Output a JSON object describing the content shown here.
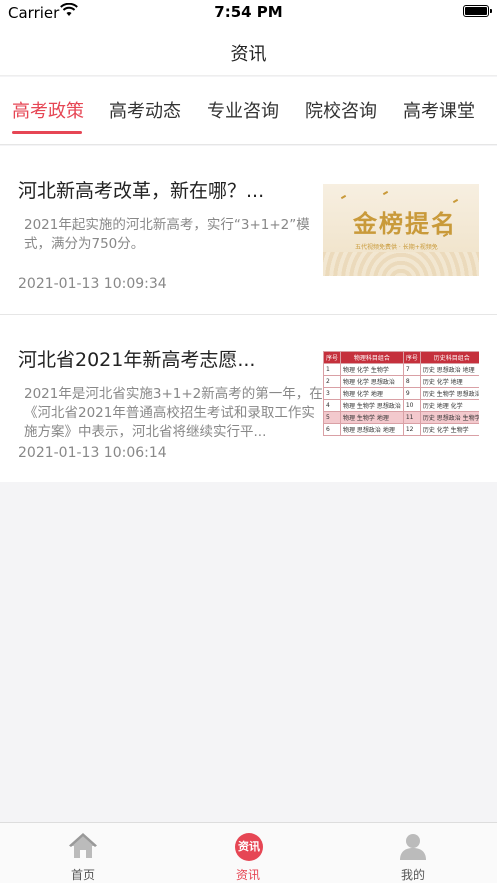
{
  "status_bar": {
    "carrier": "Carrier",
    "time": "7:54 PM"
  },
  "nav": {
    "title": "资讯"
  },
  "tabs": [
    {
      "label": "高考政策",
      "active": true
    },
    {
      "label": "高考动态",
      "active": false
    },
    {
      "label": "专业咨询",
      "active": false
    },
    {
      "label": "院校咨询",
      "active": false
    },
    {
      "label": "高考课堂",
      "active": false
    }
  ],
  "articles": [
    {
      "title": "河北新高考改革，新在哪？...",
      "summary": "2021年起实施的河北新高考，实行“3+1+2”模式，满分为750分。",
      "date": "2021-01-13 10:09:34",
      "thumb": {
        "headline": "金榜提名",
        "caption": "五代视频免费供 · 长期+视频免"
      }
    },
    {
      "title": "河北省2021年新高考志愿...",
      "summary": "2021年是河北省实施3+1+2新高考的第一年，在《河北省2021年普通高校招生考试和录取工作实施方案》中表示，河北省将继续实行平...",
      "date": "2021-01-13 10:06:14",
      "thumb": {
        "headers": [
          "序号",
          "物理科目组合",
          "序号",
          "历史科目组合"
        ],
        "rows": [
          [
            "1",
            "物理 化学 生物学",
            "7",
            "历史 思想政治 地理"
          ],
          [
            "2",
            "物理 化学 思想政治",
            "8",
            "历史 化学 地理"
          ],
          [
            "3",
            "物理 化学 地理",
            "9",
            "历史 生物学 思想政治"
          ],
          [
            "4",
            "物理 生物学 思想政治",
            "10",
            "历史 地理 化学"
          ],
          [
            "5",
            "物理 生物学 地理",
            "11",
            "历史 思想政治 生物学"
          ],
          [
            "6",
            "物理 思想政治 地理",
            "12",
            "历史 化学 生物学"
          ]
        ]
      }
    }
  ],
  "tab_bar": {
    "items": [
      {
        "label": "首页",
        "icon": "home-icon",
        "active": false
      },
      {
        "label": "资讯",
        "icon": "news-icon",
        "badge": "资讯",
        "active": true
      },
      {
        "label": "我的",
        "icon": "person-icon",
        "active": false
      }
    ]
  },
  "colors": {
    "accent": "#e64654",
    "text": "#222222",
    "muted": "#888888"
  }
}
